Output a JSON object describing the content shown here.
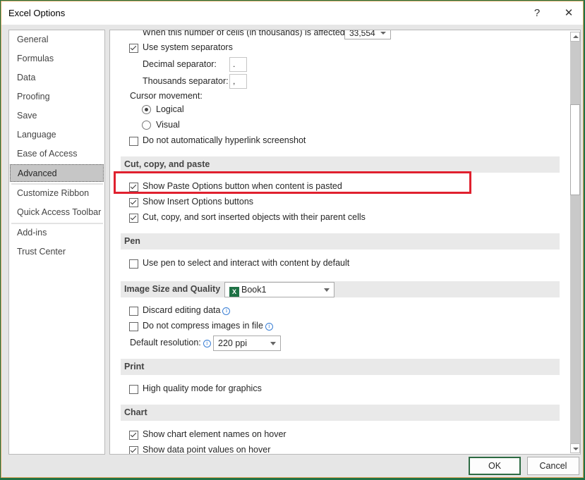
{
  "window": {
    "title": "Excel Options",
    "help_label": "?",
    "close_label": "✕"
  },
  "sidebar": {
    "items": [
      {
        "label": "General"
      },
      {
        "label": "Formulas"
      },
      {
        "label": "Data"
      },
      {
        "label": "Proofing"
      },
      {
        "label": "Save"
      },
      {
        "label": "Language"
      },
      {
        "label": "Ease of Access"
      },
      {
        "label": "Advanced",
        "active": true
      },
      {
        "label": "Customize Ribbon"
      },
      {
        "label": "Quick Access Toolbar"
      },
      {
        "label": "Add-ins"
      },
      {
        "label": "Trust Center"
      }
    ]
  },
  "content": {
    "cells_affected": {
      "label": "When this number of cells (in thousands) is affected:",
      "value": "33,554"
    },
    "use_system_separators": {
      "label": "Use system separators",
      "checked": true
    },
    "decimal_separator": {
      "label": "Decimal separator:",
      "value": "."
    },
    "thousands_separator": {
      "label": "Thousands separator:",
      "value": ","
    },
    "cursor_movement": {
      "label": "Cursor movement:",
      "options": [
        {
          "label": "Logical",
          "selected": true
        },
        {
          "label": "Visual",
          "selected": false
        }
      ]
    },
    "no_hyperlink_screenshot": {
      "label": "Do not automatically hyperlink screenshot",
      "checked": false
    },
    "sections": {
      "cut_copy_paste": {
        "title": "Cut, copy, and paste",
        "options": [
          {
            "label": "Show Paste Options button when content is pasted",
            "checked": true,
            "highlighted": true
          },
          {
            "label": "Show Insert Options buttons",
            "checked": true
          },
          {
            "label": "Cut, copy, and sort inserted objects with their parent cells",
            "checked": true
          }
        ]
      },
      "pen": {
        "title": "Pen",
        "options": [
          {
            "label": "Use pen to select and interact with content by default",
            "checked": false
          }
        ]
      },
      "image_size": {
        "title": "Image Size and Quality",
        "workbook": "Book1",
        "options": [
          {
            "label": "Discard editing data",
            "checked": false
          },
          {
            "label": "Do not compress images in file",
            "checked": false
          }
        ],
        "resolution_label": "Default resolution:",
        "resolution_value": "220 ppi"
      },
      "print": {
        "title": "Print",
        "options": [
          {
            "label": "High quality mode for graphics",
            "checked": false
          }
        ]
      },
      "chart": {
        "title": "Chart",
        "options": [
          {
            "label": "Show chart element names on hover",
            "checked": true
          },
          {
            "label": "Show data point values on hover",
            "checked": true
          }
        ]
      }
    }
  },
  "footer": {
    "ok_label": "OK",
    "cancel_label": "Cancel"
  },
  "colors": {
    "highlight": "#e0202e",
    "excel_green": "#1e7145"
  }
}
